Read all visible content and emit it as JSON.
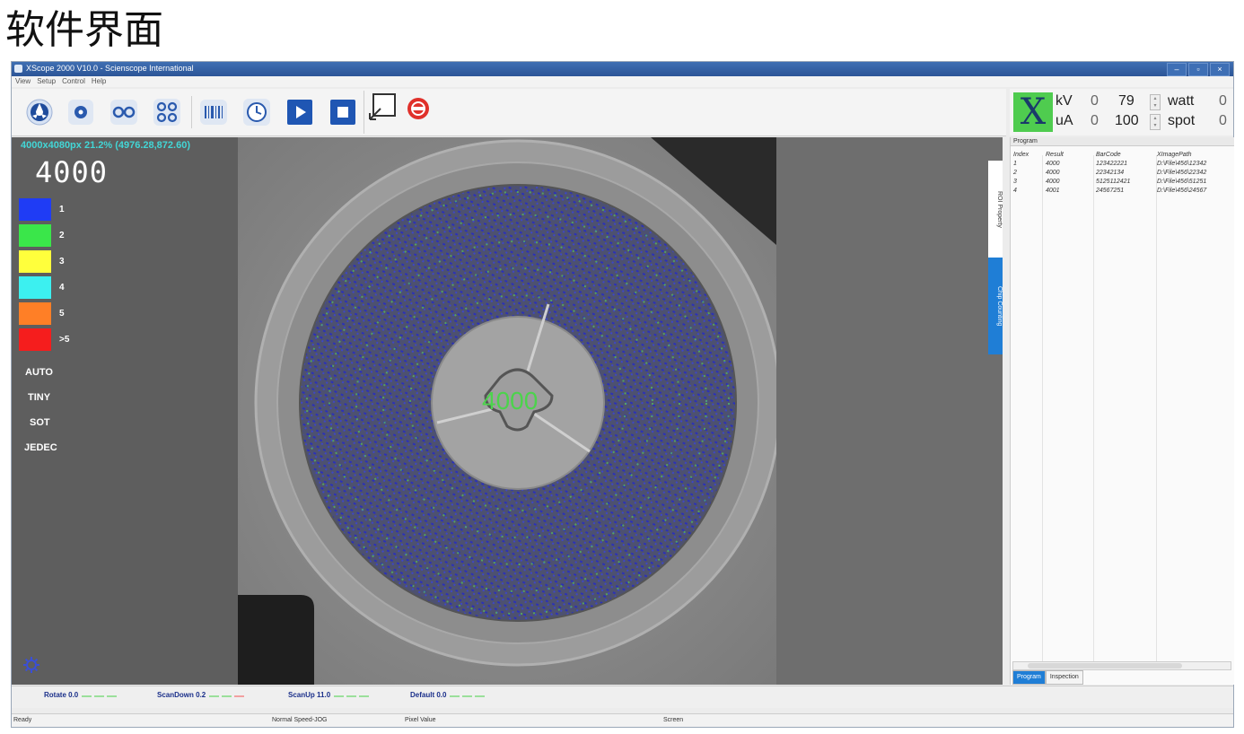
{
  "page_heading": "软件界面",
  "window": {
    "title": "XScope 2000 V10.0 - Scienscope International",
    "controls": [
      "–",
      "▫",
      "×"
    ]
  },
  "menu": [
    "View",
    "Setup",
    "Control",
    "Help"
  ],
  "toolbar": {
    "icons": [
      "reel-mode-icon",
      "single-reel-icon",
      "dual-reel-icon",
      "quad-reel-icon",
      "barcode-icon",
      "clock-icon",
      "play-icon",
      "stop-icon",
      "resize-icon",
      "power-off-icon"
    ]
  },
  "xray": {
    "logo": "X",
    "kv_label": "kV",
    "kv_value": "0",
    "kv_set": "79",
    "ua_label": "uA",
    "ua_value": "0",
    "ua_set": "100",
    "watt_label": "watt",
    "watt_value": "0",
    "spot_label": "spot",
    "spot_value": "0"
  },
  "image_info": "4000x4080px 21.2% (4976.28,872.60)",
  "big_count": "4000",
  "center_count": "4000",
  "legend": [
    {
      "label": "1",
      "color": "#1f3cf5"
    },
    {
      "label": "2",
      "color": "#3ae64a"
    },
    {
      "label": "3",
      "color": "#ffff3c"
    },
    {
      "label": "4",
      "color": "#3cf0f0"
    },
    {
      "label": "5",
      "color": "#ff7f26"
    },
    {
      "label": ">5",
      "color": "#f51d1d"
    }
  ],
  "modes": [
    "AUTO",
    "TINY",
    "SOT",
    "JEDEC"
  ],
  "side_tabs": [
    "ROI Property",
    "Chip Counting"
  ],
  "program_panel": {
    "header": "Program",
    "columns": [
      "Index",
      "Result",
      "BarCode",
      "XImagePath"
    ],
    "rows": [
      [
        "1",
        "4000",
        "123422221",
        "D:\\File\\456\\12342"
      ],
      [
        "2",
        "4000",
        "22342134",
        "D:\\File\\456\\22342"
      ],
      [
        "3",
        "4000",
        "5125112421",
        "D:\\File\\456\\51251"
      ],
      [
        "4",
        "4001",
        "24567251",
        "D:\\File\\456\\24567"
      ]
    ],
    "tabs": [
      "Program",
      "Inspection"
    ]
  },
  "jog": [
    {
      "label": "Rotate 0.0"
    },
    {
      "label": "ScanDown 0.2"
    },
    {
      "label": "ScanUp 11.0"
    },
    {
      "label": "Default 0.0"
    }
  ],
  "status": {
    "state": "Ready",
    "speed": "Normal Speed-JOG",
    "pixel": "Pixel Value",
    "screen": "Screen"
  }
}
